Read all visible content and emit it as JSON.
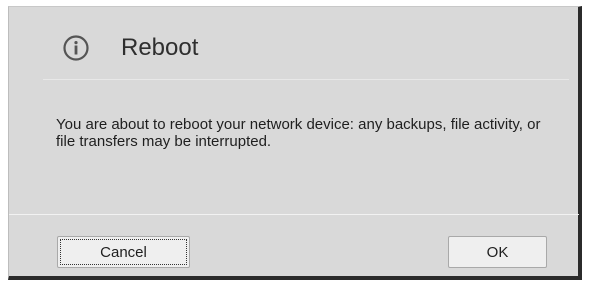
{
  "dialog": {
    "title": "Reboot",
    "icon": "info-icon",
    "message": "You are about to reboot your network device: any backups, file activity, or file transfers may be interrupted.",
    "buttons": {
      "cancel_label": "Cancel",
      "ok_label": "OK"
    },
    "colors": {
      "background": "#d9d9d9",
      "icon_stroke": "#555555",
      "title_text": "#2f2f2f"
    }
  }
}
